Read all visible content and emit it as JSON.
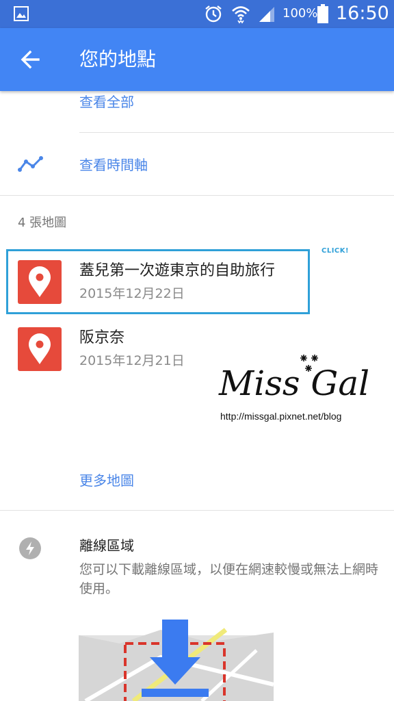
{
  "status_bar": {
    "battery_percent": "100%",
    "time": "16:50",
    "icons": [
      "gallery-icon",
      "alarm-icon",
      "wifi-icon",
      "signal-icon",
      "battery-icon"
    ]
  },
  "app_bar": {
    "title": "您的地點",
    "back_icon": "arrow-back-icon",
    "color": "#4285f4"
  },
  "links": {
    "view_all": "查看全部",
    "view_timeline": "查看時間軸",
    "more_maps": "更多地圖"
  },
  "maps_section": {
    "count_label": "4 張地圖",
    "items": [
      {
        "title": "蓋兒第一次遊東京的自助旅行",
        "date": "2015年12月22日"
      },
      {
        "title": "阪京奈",
        "date": "2015年12月21日"
      }
    ]
  },
  "annotation": {
    "click_note": "CLICK!"
  },
  "watermark": {
    "script": "Miss Gal",
    "url": "http://missgal.pixnet.net/blog"
  },
  "offline": {
    "title": "離線區域",
    "description": "您可以下載離線區域，以便在網速較慢或無法上網時使用。",
    "icon": "offline-bolt-icon"
  },
  "colors": {
    "accent": "#4a86e8",
    "pin_tile": "#e64a3b",
    "highlight": "#2fa0d8"
  }
}
